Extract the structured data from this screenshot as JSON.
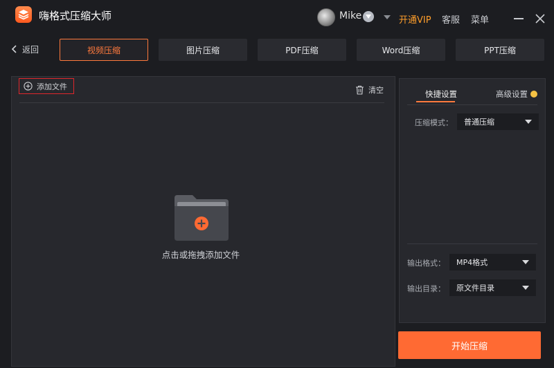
{
  "app": {
    "title": "嗨格式压缩大师"
  },
  "user": {
    "name": "Mike"
  },
  "header": {
    "open_vip": "开通VIP",
    "service": "客服",
    "menu": "菜单"
  },
  "nav": {
    "back": "返回"
  },
  "tabs": [
    {
      "label": "视频压缩",
      "active": true
    },
    {
      "label": "图片压缩",
      "active": false
    },
    {
      "label": "PDF压缩",
      "active": false
    },
    {
      "label": "Word压缩",
      "active": false
    },
    {
      "label": "PPT压缩",
      "active": false
    }
  ],
  "file_panel": {
    "add_file": "添加文件",
    "clear": "清空",
    "drop_hint": "点击或拖拽添加文件"
  },
  "settings": {
    "tab_quick": "快捷设置",
    "tab_advanced": "高级设置",
    "compress_mode_label": "压缩模式：",
    "compress_mode_value": "普通压缩",
    "output_format_label": "输出格式：",
    "output_format_value": "MP4格式",
    "output_dir_label": "输出目录：",
    "output_dir_value": "原文件目录"
  },
  "actions": {
    "start": "开始压缩"
  },
  "colors": {
    "accent": "#ff6a33",
    "vip": "#ff9e2b",
    "highlight": "#e0262b"
  }
}
